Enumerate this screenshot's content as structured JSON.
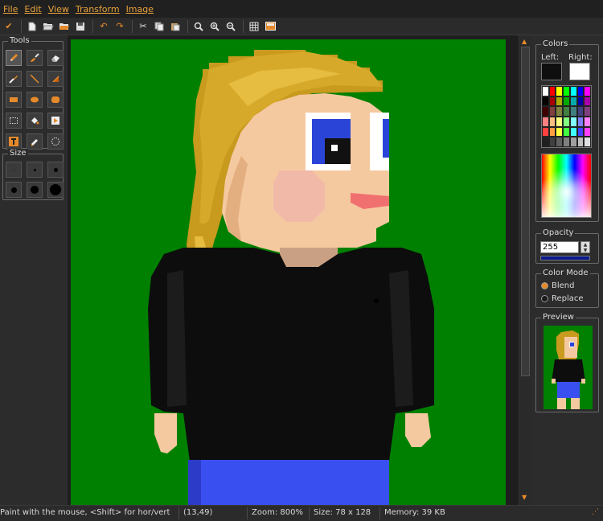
{
  "menu": [
    "File",
    "Edit",
    "View",
    "Transform",
    "Image"
  ],
  "toolbar": {
    "icons": [
      "check-icon",
      "new-file-icon",
      "open-file-icon",
      "open-recent-icon",
      "save-icon",
      "undo-icon",
      "redo-icon",
      "cut-icon",
      "copy-icon",
      "paste-icon",
      "zoom-fit-icon",
      "zoom-in-icon",
      "zoom-out-icon",
      "grid-icon",
      "toggle-preview-icon"
    ]
  },
  "tools": {
    "title": "Tools",
    "items": [
      "pencil",
      "brush",
      "eraser",
      "color-picker",
      "line",
      "gradient",
      "rectangle",
      "ellipse",
      "rounded-rectangle",
      "selection",
      "fill",
      "flood-fill",
      "text",
      "spray",
      "lasso"
    ]
  },
  "size": {
    "title": "Size",
    "options": [
      1,
      2,
      3,
      4,
      6,
      8
    ]
  },
  "colors": {
    "title": "Colors",
    "left_label": "Left:",
    "right_label": "Right:",
    "left_color": "#0f0f0f",
    "right_color": "#ffffff",
    "palette": [
      [
        "#ffffff",
        "#ff0000",
        "#ffff00",
        "#00ff00",
        "#00ffff",
        "#0000ff",
        "#ff00ff"
      ],
      [
        "#000000",
        "#aa0000",
        "#aaaa00",
        "#00aa00",
        "#00aaaa",
        "#0000aa",
        "#aa00aa"
      ],
      [
        "#400000",
        "#804040",
        "#808040",
        "#408040",
        "#408080",
        "#404080",
        "#804080"
      ],
      [
        "#ff8080",
        "#ffbf80",
        "#ffff80",
        "#80ff80",
        "#80ffff",
        "#8080ff",
        "#ff80ff"
      ],
      [
        "#ff4040",
        "#ff9f40",
        "#ffff40",
        "#40ff40",
        "#40ffff",
        "#4040ff",
        "#ff40ff"
      ],
      [
        "#202020",
        "#404040",
        "#606060",
        "#808080",
        "#a0a0a0",
        "#c0c0c0",
        "#e0e0e0"
      ]
    ]
  },
  "opacity": {
    "title": "Opacity",
    "value": "255"
  },
  "color_mode": {
    "title": "Color Mode",
    "options": [
      "Blend",
      "Replace"
    ],
    "selected": "Blend"
  },
  "preview": {
    "title": "Preview"
  },
  "status": {
    "hint": "Paint with the mouse, <Shift> for hor/vert",
    "coords": "(13,49)",
    "zoom": "Zoom: 800%",
    "size": "Size: 78 x 128",
    "memory": "Memory: 39 KB"
  }
}
